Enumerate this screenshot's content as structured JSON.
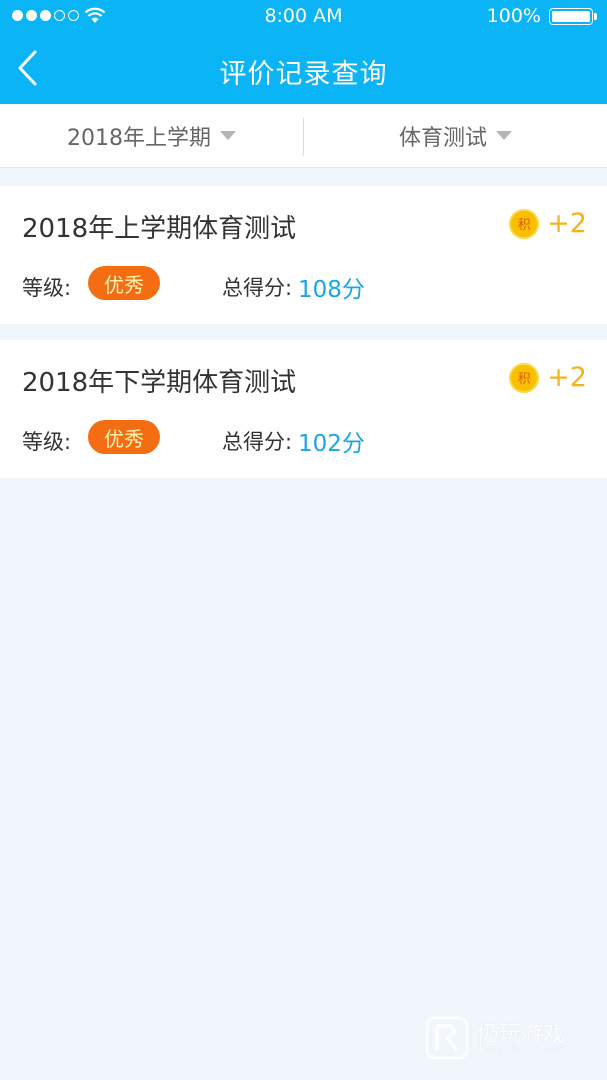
{
  "status_bar": {
    "time": "8:00 AM",
    "battery": "100%"
  },
  "nav": {
    "title": "评价记录查询",
    "back_icon": "chevron-left-icon"
  },
  "filters": [
    {
      "label": "2018年上学期",
      "icon": "caret-down-icon"
    },
    {
      "label": "体育测试",
      "icon": "caret-down-icon"
    }
  ],
  "records": [
    {
      "title": "2018年上学期体育测试",
      "points_icon": "积",
      "points": "+2",
      "grade_label": "等级:",
      "grade": "优秀",
      "score_label": "总得分:",
      "score": "108分"
    },
    {
      "title": "2018年下学期体育测试",
      "points_icon": "积",
      "points": "+2",
      "grade_label": "等级:",
      "grade": "优秀",
      "score_label": "总得分:",
      "score": "102分"
    }
  ],
  "watermark": {
    "name": "仍玩游戏",
    "sub": "Rengwan Games"
  },
  "colors": {
    "header": "#0bb4f4",
    "background": "#f1f5fc",
    "grade_badge": "#f46d13",
    "score": "#1aa6e6",
    "points": "#f6b21a"
  }
}
